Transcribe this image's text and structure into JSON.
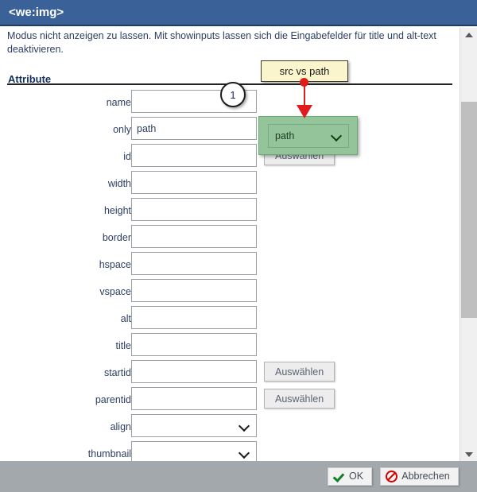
{
  "window": {
    "title": "<we:img>"
  },
  "content": {
    "intro_text": "Modus nicht anzeigen zu lassen. Mit showinputs lassen sich die Eingabefelder für title und alt-text deaktivieren.",
    "section_title": "Attribute"
  },
  "form": {
    "select_button_label": "Auswählen",
    "rows": [
      {
        "label": "name",
        "type": "text",
        "value": "",
        "has_button": false
      },
      {
        "label": "only",
        "type": "text",
        "value": "path",
        "has_button": false
      },
      {
        "label": "id",
        "type": "text",
        "value": "",
        "has_button": true
      },
      {
        "label": "width",
        "type": "text",
        "value": "",
        "has_button": false
      },
      {
        "label": "height",
        "type": "text",
        "value": "",
        "has_button": false
      },
      {
        "label": "border",
        "type": "text",
        "value": "",
        "has_button": false
      },
      {
        "label": "hspace",
        "type": "text",
        "value": "",
        "has_button": false
      },
      {
        "label": "vspace",
        "type": "text",
        "value": "",
        "has_button": false
      },
      {
        "label": "alt",
        "type": "text",
        "value": "",
        "has_button": false
      },
      {
        "label": "title",
        "type": "text",
        "value": "",
        "has_button": false
      },
      {
        "label": "startid",
        "type": "text",
        "value": "",
        "has_button": true
      },
      {
        "label": "parentid",
        "type": "text",
        "value": "",
        "has_button": true
      },
      {
        "label": "align",
        "type": "select",
        "value": "",
        "has_button": false
      },
      {
        "label": "thumbnail",
        "type": "select",
        "value": "",
        "has_button": false
      }
    ]
  },
  "annotations": {
    "badge_number": "1",
    "callout_text": "src vs path",
    "highlight_select_value": "path"
  },
  "footer": {
    "ok_label": "OK",
    "cancel_label": "Abbrechen"
  },
  "scrollbar": {
    "up_icon": "triangle-up-icon",
    "down_icon": "triangle-down-icon"
  },
  "colors": {
    "titlebar": "#3a6298",
    "footer": "#a3a8ad",
    "highlight": "#93c49a",
    "callout": "#faf5cd",
    "arrow": "#e01b1b"
  }
}
